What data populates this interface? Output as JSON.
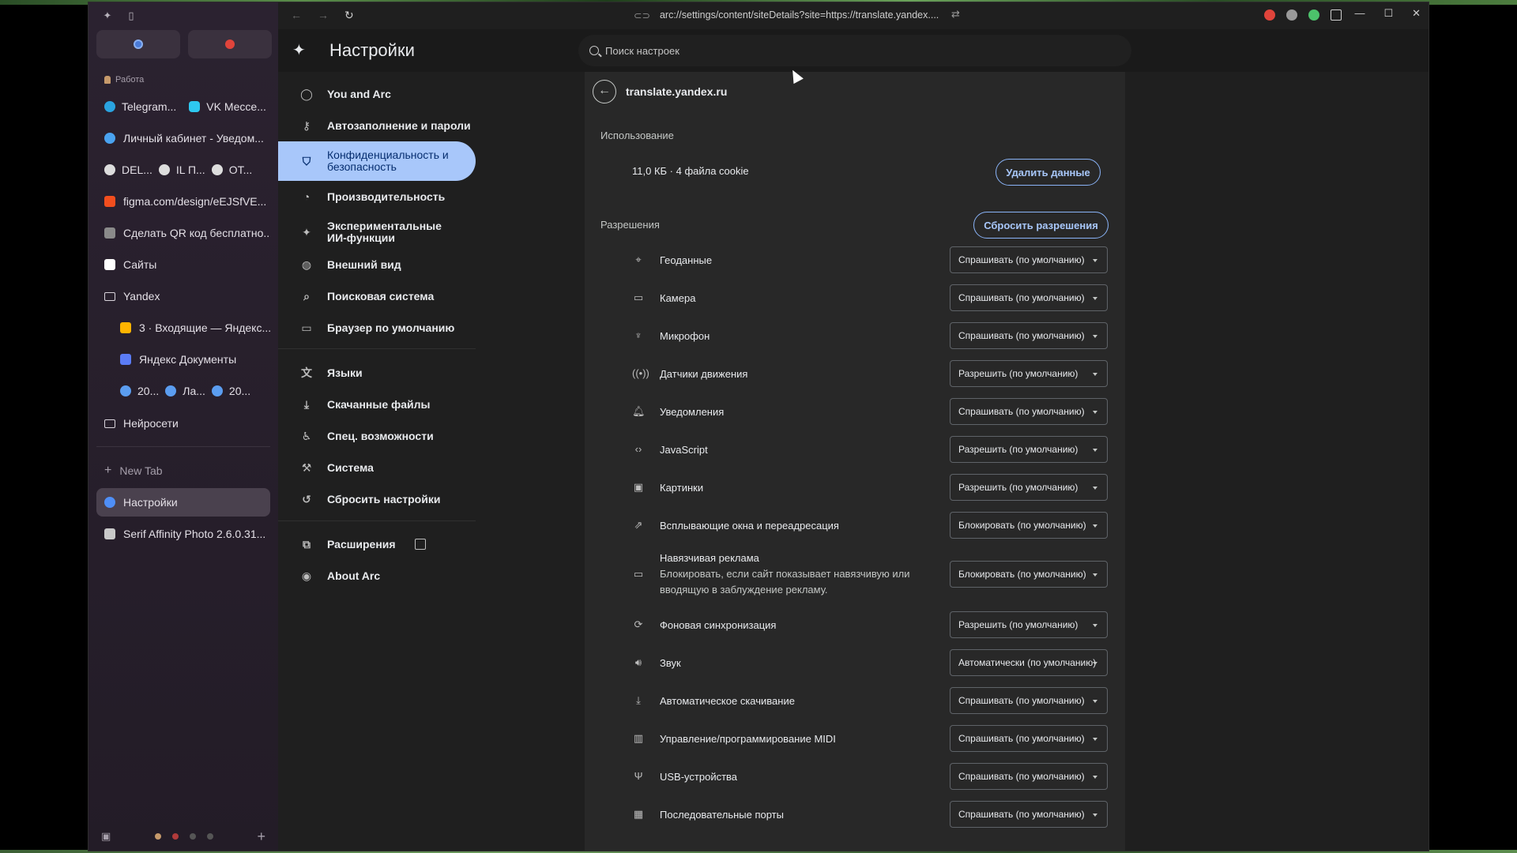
{
  "browser": {
    "url": "arc://settings/content/siteDetails?site=https://translate.yandex...."
  },
  "sidebar": {
    "space_label": "Работа",
    "multi_rows": [
      {
        "items": [
          "Telegram...",
          "VK Мессе..."
        ]
      },
      {
        "items": [
          "DEL...",
          "IL П...",
          "OT..."
        ]
      },
      {
        "items": [
          "20...",
          "Ла...",
          "20..."
        ]
      }
    ],
    "items": [
      {
        "label": "Личный кабинет - Уведом...",
        "color": "#4aa3f0"
      },
      {
        "label": "figma.com/design/eEJSfVE...",
        "color": "#f24e1e"
      },
      {
        "label": "Сделать QR код бесплатно...",
        "color": "#8a8a8a"
      },
      {
        "label": "Сайты",
        "color": "#ffffff"
      },
      {
        "label": "Yandex",
        "color": "#ffffff"
      },
      {
        "label": "3 · Входящие — Яндекс...",
        "color": "#ffb400"
      },
      {
        "label": "Яндекс Документы",
        "color": "#5b7cf6"
      },
      {
        "label": "Нейросети",
        "color": "#ffffff"
      }
    ],
    "new_tab": "New Tab",
    "active_tab": "Настройки",
    "last_tab": "Serif Affinity Photo 2.6.0.31..."
  },
  "settings": {
    "title": "Настройки",
    "search_placeholder": "Поиск настроек",
    "nav": [
      {
        "label": "You and Arc",
        "icon": "person-icon"
      },
      {
        "label": "Автозаполнение и пароли",
        "icon": "key-icon"
      },
      {
        "label": "Конфиденциальность и безопасность",
        "icon": "shield-icon"
      },
      {
        "label": "Производительность",
        "icon": "speedometer-icon"
      },
      {
        "label": "Экспериментальные ИИ-функции",
        "icon": "sparkle-icon"
      },
      {
        "label": "Внешний вид",
        "icon": "palette-icon"
      },
      {
        "label": "Поисковая система",
        "icon": "search-icon"
      },
      {
        "label": "Браузер по умолчанию",
        "icon": "browser-icon"
      },
      {
        "label": "Языки",
        "icon": "translate-icon"
      },
      {
        "label": "Скачанные файлы",
        "icon": "download-icon"
      },
      {
        "label": "Спец. возможности",
        "icon": "accessibility-icon"
      },
      {
        "label": "Система",
        "icon": "wrench-icon"
      },
      {
        "label": "Сбросить настройки",
        "icon": "reset-icon"
      },
      {
        "label": "Расширения",
        "icon": "puzzle-icon"
      },
      {
        "label": "About Arc",
        "icon": "arc-logo-icon"
      }
    ]
  },
  "site": {
    "name": "translate.yandex.ru",
    "usage_title": "Использование",
    "usage_text": "11,0 КБ · 4 файла cookie",
    "delete_button": "Удалить данные",
    "permissions_title": "Разрешения",
    "reset_button": "Сбросить разрешения",
    "permissions": [
      {
        "label": "Геоданные",
        "value": "Спрашивать (по умолчанию)",
        "icon": "location-icon"
      },
      {
        "label": "Камера",
        "value": "Спрашивать (по умолчанию)",
        "icon": "camera-icon"
      },
      {
        "label": "Микрофон",
        "value": "Спрашивать (по умолчанию)",
        "icon": "mic-icon"
      },
      {
        "label": "Датчики движения",
        "value": "Разрешить (по умолчанию)",
        "icon": "sensors-icon"
      },
      {
        "label": "Уведомления",
        "value": "Спрашивать (по умолчанию)",
        "icon": "bell-icon"
      },
      {
        "label": "JavaScript",
        "value": "Разрешить (по умолчанию)",
        "icon": "code-icon"
      },
      {
        "label": "Картинки",
        "value": "Разрешить (по умолчанию)",
        "icon": "image-icon"
      },
      {
        "label": "Всплывающие окна и переадресация",
        "value": "Блокировать (по умолчанию)",
        "icon": "popup-icon"
      },
      {
        "label": "Навязчивая реклама",
        "desc": "Блокировать, если сайт показывает навязчивую или вводящую в заблуждение рекламу.",
        "value": "Блокировать (по умолчанию)",
        "icon": "ads-icon"
      },
      {
        "label": "Фоновая синхронизация",
        "value": "Разрешить (по умолчанию)",
        "icon": "sync-icon"
      },
      {
        "label": "Звук",
        "value": "Автоматически (по умолчанию)",
        "icon": "sound-icon"
      },
      {
        "label": "Автоматическое скачивание",
        "value": "Спрашивать (по умолчанию)",
        "icon": "download-icon"
      },
      {
        "label": "Управление/программирование MIDI",
        "value": "Спрашивать (по умолчанию)",
        "icon": "piano-icon"
      },
      {
        "label": "USB-устройства",
        "value": "Спрашивать (по умолчанию)",
        "icon": "usb-icon"
      },
      {
        "label": "Последовательные порты",
        "value": "Спрашивать (по умолчанию)",
        "icon": "serial-port-icon"
      }
    ]
  }
}
